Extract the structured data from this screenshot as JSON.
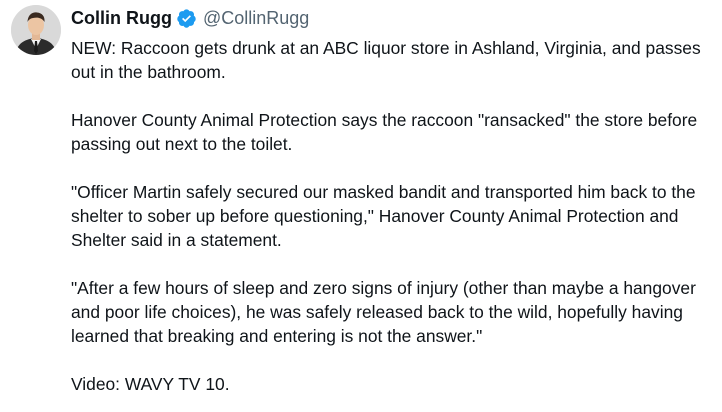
{
  "author": {
    "name": "Collin Rugg",
    "handle": "@CollinRugg",
    "verified_color": "#1d9bf0"
  },
  "icons": {
    "avatar": "profile-photo",
    "badge": "verified-badge-icon"
  },
  "tweet": {
    "paragraphs": [
      "NEW: Raccoon gets drunk at an ABC liquor store in Ashland, Virginia, and passes out in the bathroom.",
      "Hanover County Animal Protection says the raccoon \"ransacked\" the store before passing out next to the toilet.",
      "\"Officer Martin safely secured our masked bandit and transported him back to the shelter to sober up before questioning,\" Hanover County Animal Protection and Shelter said in a statement.",
      "\"After a few hours of sleep and zero signs of injury (other than maybe a hangover and poor life choices), he was safely released back to the wild, hopefully having learned that breaking and entering is not the answer.\"",
      "Video: WAVY TV 10."
    ]
  }
}
